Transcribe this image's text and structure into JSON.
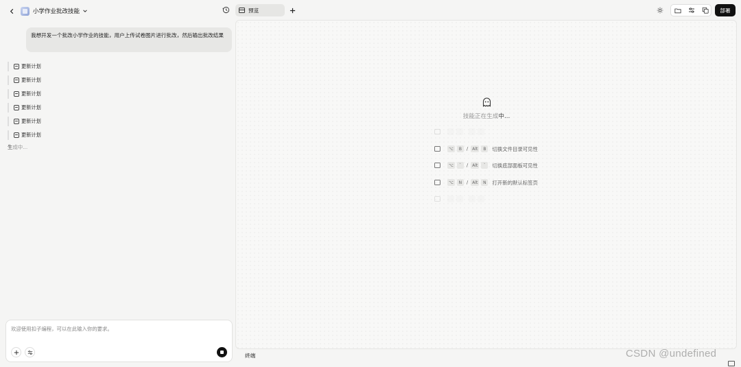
{
  "header": {
    "project_title": "小学作业批改技能"
  },
  "chat": {
    "user_message": "我想开发一个批改小学作业的技能，用户上传试卷图片进行批改，然后输出批改结果",
    "plan_items": [
      "更新计划",
      "更新计划",
      "更新计划",
      "更新计划",
      "更新计划",
      "更新计划"
    ],
    "status_dark": "生",
    "status_light": "成中..."
  },
  "input": {
    "placeholder": "欢迎使用扣子编程，可以在此输入你的要求。"
  },
  "tabs": {
    "preview_label": "预览"
  },
  "toolbar": {
    "deploy_label": "部署"
  },
  "preview": {
    "status_light": "技能正在生成",
    "status_dark": "中...",
    "shortcuts": [
      {
        "k1": "⌥",
        "k2": "B",
        "alt": "Alt",
        "k3": "B",
        "label": "切换文件目录可见性"
      },
      {
        "k1": "⌥",
        "k2": "`",
        "alt": "Alt",
        "k3": "`",
        "label": "切换底部面板可见性"
      },
      {
        "k1": "⌥",
        "k2": "N",
        "alt": "Alt",
        "k3": "N",
        "label": "打开新的默认标签页"
      }
    ]
  },
  "bottom": {
    "terminal_label": "终端",
    "watermark": "CSDN @undefined"
  }
}
